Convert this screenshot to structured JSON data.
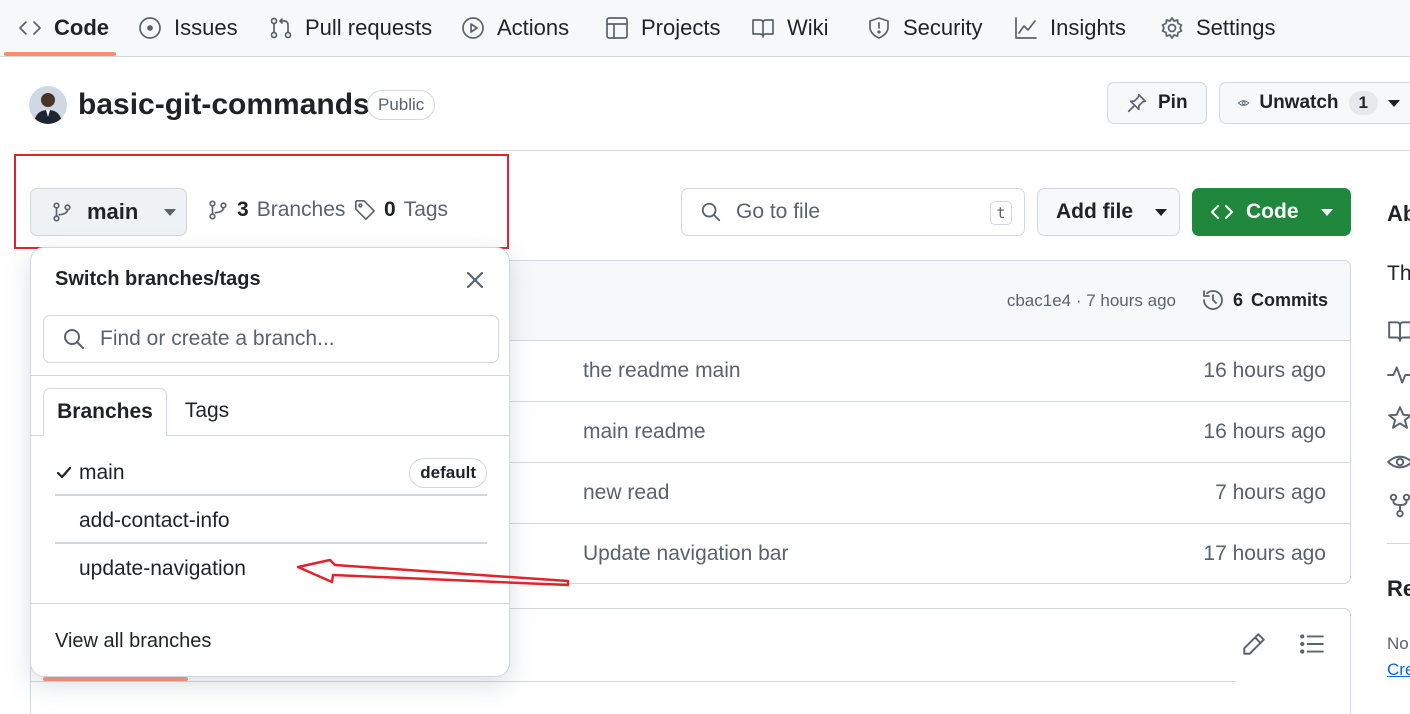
{
  "nav": {
    "tabs": [
      {
        "label": "Code",
        "icon": "code-icon"
      },
      {
        "label": "Issues",
        "icon": "issue-icon"
      },
      {
        "label": "Pull requests",
        "icon": "pull-request-icon"
      },
      {
        "label": "Actions",
        "icon": "play-icon"
      },
      {
        "label": "Projects",
        "icon": "table-icon"
      },
      {
        "label": "Wiki",
        "icon": "book-icon"
      },
      {
        "label": "Security",
        "icon": "shield-icon"
      },
      {
        "label": "Insights",
        "icon": "graph-icon"
      },
      {
        "label": "Settings",
        "icon": "gear-icon"
      }
    ],
    "active_tab": "Code"
  },
  "repo": {
    "name": "basic-git-commands",
    "visibility": "Public",
    "pin_label": "Pin",
    "unwatch_label": "Unwatch",
    "watch_count": "1"
  },
  "branch_bar": {
    "current_branch": "main",
    "branches_count": "3",
    "branches_label": "Branches",
    "tags_count": "0",
    "tags_label": "Tags",
    "search_placeholder": "Go to file",
    "search_shortcut": "t",
    "add_file_label": "Add file",
    "code_label": "Code"
  },
  "latest_commit": {
    "info": "cbac1e4 · 7 hours ago",
    "commits_count": "6",
    "commits_label": "Commits"
  },
  "files": [
    {
      "message": "the readme main",
      "time": "16 hours ago"
    },
    {
      "message": "main readme",
      "time": "16 hours ago"
    },
    {
      "message": "new read",
      "time": "7 hours ago"
    },
    {
      "message": "Update navigation bar",
      "time": "17 hours ago"
    }
  ],
  "sidebar": {
    "about_heading": "Ab",
    "about_text": "Th",
    "releases_heading": "Re",
    "releases_text": "No",
    "releases_link": "Cre"
  },
  "dropdown": {
    "title": "Switch branches/tags",
    "search_placeholder": "Find or create a branch...",
    "tab_branches": "Branches",
    "tab_tags": "Tags",
    "branches": [
      {
        "name": "main",
        "selected": true,
        "badge": "default"
      },
      {
        "name": "add-contact-info",
        "selected": false,
        "badge": ""
      },
      {
        "name": "update-navigation",
        "selected": false,
        "badge": ""
      }
    ],
    "footer_link": "View all branches"
  },
  "colors": {
    "accent_green": "#1f883d",
    "tab_underline": "#fd8c73",
    "annotation_red": "#e0242d",
    "link_blue": "#0969da"
  }
}
